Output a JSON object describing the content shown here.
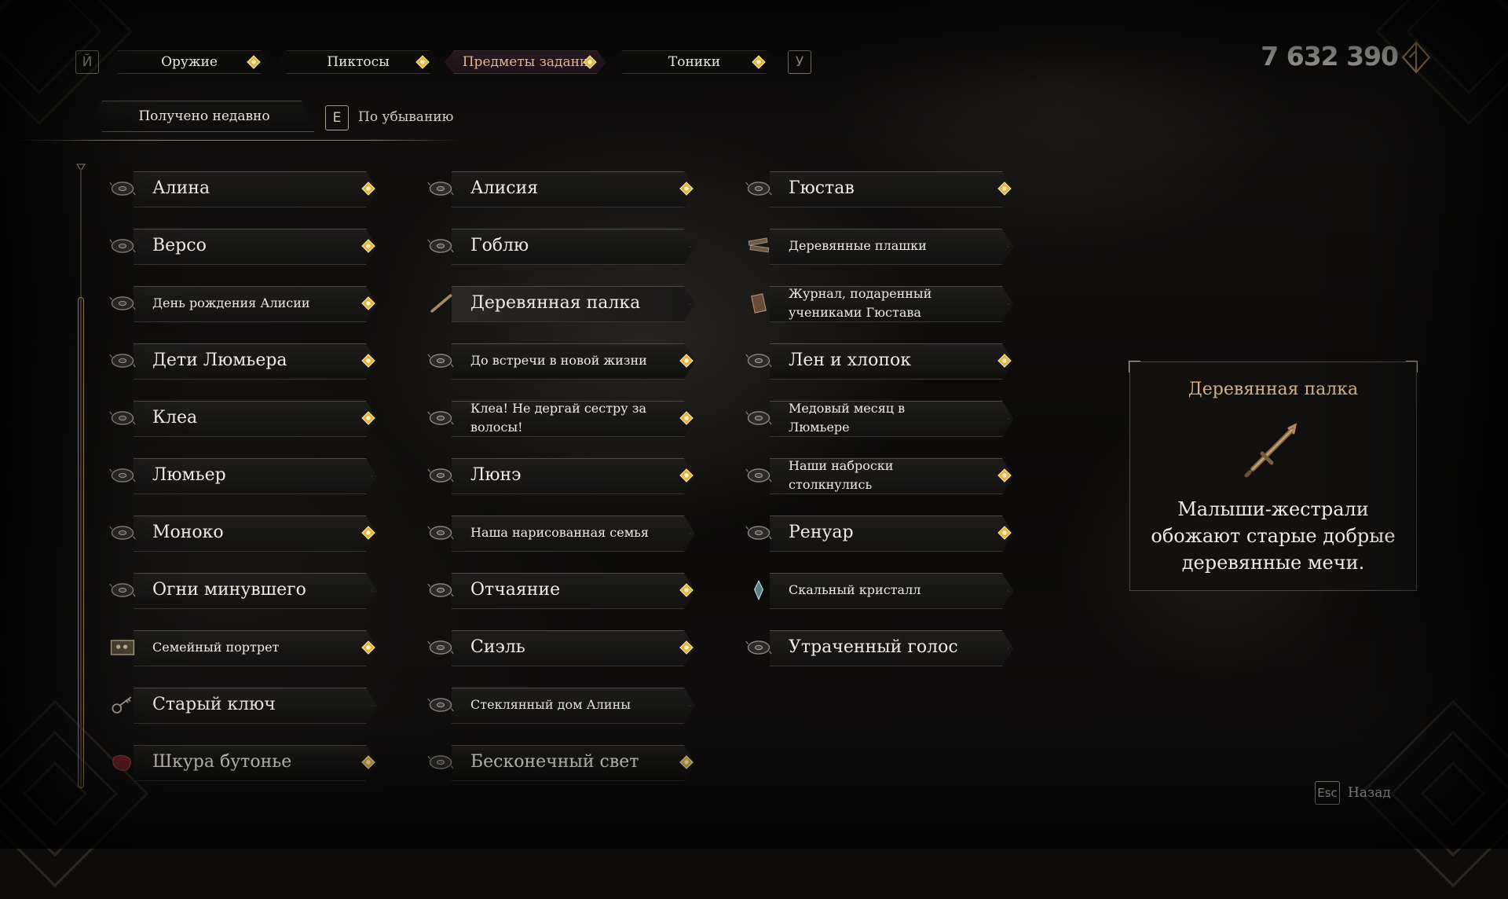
{
  "tabs": {
    "prev_key": "Й",
    "next_key": "У",
    "items": [
      {
        "label": "Оружие",
        "active": false
      },
      {
        "label": "Пиктосы",
        "active": false
      },
      {
        "label": "Предметы задани",
        "active": true
      },
      {
        "label": "Тоники",
        "active": false
      }
    ]
  },
  "currency": {
    "amount": "7 632 390",
    "icon": "chroma-icon"
  },
  "sort": {
    "mode": "Получено недавно",
    "order_key": "E",
    "order_label": "По убыванию"
  },
  "items": [
    {
      "name": "Алина",
      "size": "large",
      "new": true,
      "icon": "record-icon"
    },
    {
      "name": "Версо",
      "size": "large",
      "new": true,
      "icon": "record-icon"
    },
    {
      "name": "День рождения Алисии",
      "size": "small",
      "new": true,
      "icon": "record-icon"
    },
    {
      "name": "Дети Люмьера",
      "size": "large",
      "new": true,
      "icon": "record-icon"
    },
    {
      "name": "Клеа",
      "size": "large",
      "new": true,
      "icon": "record-icon"
    },
    {
      "name": "Люмьер",
      "size": "large",
      "new": false,
      "icon": "record-icon"
    },
    {
      "name": "Моноко",
      "size": "large",
      "new": true,
      "icon": "record-icon"
    },
    {
      "name": "Огни минувшего",
      "size": "large",
      "new": false,
      "icon": "record-icon"
    },
    {
      "name": "Семейный портрет",
      "size": "small",
      "new": true,
      "icon": "portrait-icon"
    },
    {
      "name": "Старый ключ",
      "size": "large",
      "new": false,
      "icon": "key-icon"
    },
    {
      "name": "Шкура бутонье",
      "size": "large",
      "new": true,
      "icon": "hide-icon"
    },
    {
      "name": "Алисия",
      "size": "large",
      "new": true,
      "icon": "record-icon"
    },
    {
      "name": "Гоблю",
      "size": "large",
      "new": false,
      "icon": "record-icon"
    },
    {
      "name": "Деревянная палка",
      "size": "large",
      "new": false,
      "icon": "stick-icon",
      "selected": true
    },
    {
      "name": "До встречи в новой жизни",
      "size": "small",
      "new": true,
      "icon": "record-icon"
    },
    {
      "name": "Клеа! Не дергай сестру за волосы!",
      "size": "small",
      "new": true,
      "icon": "record-icon"
    },
    {
      "name": "Люнэ",
      "size": "large",
      "new": true,
      "icon": "record-icon"
    },
    {
      "name": "Наша нарисованная семья",
      "size": "small",
      "new": false,
      "icon": "record-icon"
    },
    {
      "name": "Отчаяние",
      "size": "large",
      "new": true,
      "icon": "record-icon"
    },
    {
      "name": "Сиэль",
      "size": "large",
      "new": true,
      "icon": "record-icon"
    },
    {
      "name": "Стеклянный дом Алины",
      "size": "small",
      "new": false,
      "icon": "record-icon"
    },
    {
      "name": "Бесконечный свет",
      "size": "large",
      "new": true,
      "icon": "record-icon"
    },
    {
      "name": "Гюстав",
      "size": "large",
      "new": true,
      "icon": "record-icon"
    },
    {
      "name": "Деревянные плашки",
      "size": "small",
      "new": false,
      "icon": "planks-icon"
    },
    {
      "name": "Журнал, подаренный учениками Гюстава",
      "size": "small",
      "new": false,
      "icon": "journal-icon"
    },
    {
      "name": "Лен и хлопок",
      "size": "large",
      "new": true,
      "icon": "record-icon"
    },
    {
      "name": "Медовый месяц в Люмьере",
      "size": "small",
      "new": false,
      "icon": "record-icon"
    },
    {
      "name": "Наши наброски столкнулись",
      "size": "small",
      "new": true,
      "icon": "record-icon"
    },
    {
      "name": "Ренуар",
      "size": "large",
      "new": true,
      "icon": "record-icon"
    },
    {
      "name": "Скальный кристалл",
      "size": "small",
      "new": false,
      "icon": "crystal-icon"
    },
    {
      "name": "Утраченный голос",
      "size": "large",
      "new": false,
      "icon": "record-icon"
    }
  ],
  "detail": {
    "title": "Деревянная палка",
    "icon": "wooden-stick-icon",
    "description": "Малыши-жестрали обожают старые добрые деревянные мечи."
  },
  "back": {
    "key": "Esc",
    "label": "Назад"
  },
  "colors": {
    "accent_gold": "#d9b181",
    "active_tab": "#4a2f3c",
    "gem": "#e8b33a"
  }
}
